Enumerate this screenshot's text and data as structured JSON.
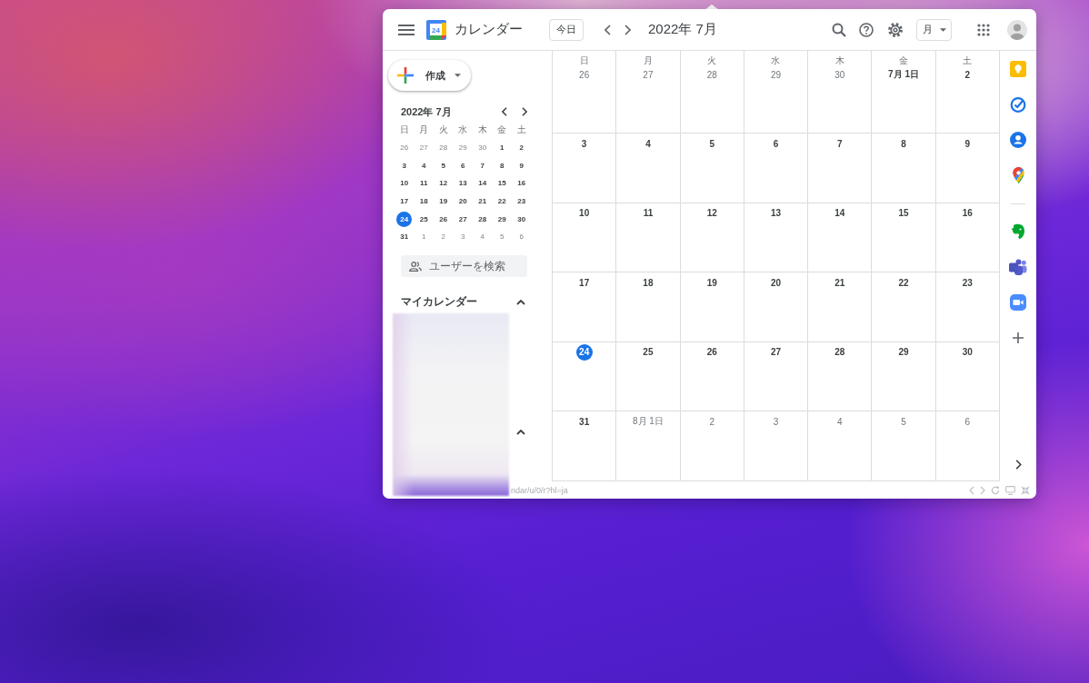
{
  "header": {
    "logo_text": "24",
    "app_name": "カレンダー",
    "today_button": "今日",
    "period": "2022年 7月",
    "view_selector": "月"
  },
  "sidebar": {
    "create_button": "作成",
    "mini_calendar": {
      "title": "2022年 7月",
      "weekdays": [
        "日",
        "月",
        "火",
        "水",
        "木",
        "金",
        "土"
      ],
      "weeks": [
        [
          {
            "label": "26",
            "in_month": false,
            "selected": false
          },
          {
            "label": "27",
            "in_month": false,
            "selected": false
          },
          {
            "label": "28",
            "in_month": false,
            "selected": false
          },
          {
            "label": "29",
            "in_month": false,
            "selected": false
          },
          {
            "label": "30",
            "in_month": false,
            "selected": false
          },
          {
            "label": "1",
            "in_month": true,
            "selected": false
          },
          {
            "label": "2",
            "in_month": true,
            "selected": false
          }
        ],
        [
          {
            "label": "3",
            "in_month": true,
            "selected": false
          },
          {
            "label": "4",
            "in_month": true,
            "selected": false
          },
          {
            "label": "5",
            "in_month": true,
            "selected": false
          },
          {
            "label": "6",
            "in_month": true,
            "selected": false
          },
          {
            "label": "7",
            "in_month": true,
            "selected": false
          },
          {
            "label": "8",
            "in_month": true,
            "selected": false
          },
          {
            "label": "9",
            "in_month": true,
            "selected": false
          }
        ],
        [
          {
            "label": "10",
            "in_month": true,
            "selected": false
          },
          {
            "label": "11",
            "in_month": true,
            "selected": false
          },
          {
            "label": "12",
            "in_month": true,
            "selected": false
          },
          {
            "label": "13",
            "in_month": true,
            "selected": false
          },
          {
            "label": "14",
            "in_month": true,
            "selected": false
          },
          {
            "label": "15",
            "in_month": true,
            "selected": false
          },
          {
            "label": "16",
            "in_month": true,
            "selected": false
          }
        ],
        [
          {
            "label": "17",
            "in_month": true,
            "selected": false
          },
          {
            "label": "18",
            "in_month": true,
            "selected": false
          },
          {
            "label": "19",
            "in_month": true,
            "selected": false
          },
          {
            "label": "20",
            "in_month": true,
            "selected": false
          },
          {
            "label": "21",
            "in_month": true,
            "selected": false
          },
          {
            "label": "22",
            "in_month": true,
            "selected": false
          },
          {
            "label": "23",
            "in_month": true,
            "selected": false
          }
        ],
        [
          {
            "label": "24",
            "in_month": true,
            "selected": true
          },
          {
            "label": "25",
            "in_month": true,
            "selected": false
          },
          {
            "label": "26",
            "in_month": true,
            "selected": false
          },
          {
            "label": "27",
            "in_month": true,
            "selected": false
          },
          {
            "label": "28",
            "in_month": true,
            "selected": false
          },
          {
            "label": "29",
            "in_month": true,
            "selected": false
          },
          {
            "label": "30",
            "in_month": true,
            "selected": false
          }
        ],
        [
          {
            "label": "31",
            "in_month": true,
            "selected": false
          },
          {
            "label": "1",
            "in_month": false,
            "selected": false
          },
          {
            "label": "2",
            "in_month": false,
            "selected": false
          },
          {
            "label": "3",
            "in_month": false,
            "selected": false
          },
          {
            "label": "4",
            "in_month": false,
            "selected": false
          },
          {
            "label": "5",
            "in_month": false,
            "selected": false
          },
          {
            "label": "6",
            "in_month": false,
            "selected": false
          }
        ]
      ]
    },
    "people_search": {
      "placeholder": "ユーザーを検索"
    },
    "calendar_sections": [
      {
        "title": "マイカレンダー",
        "expanded": true
      },
      {
        "expanded": true
      }
    ]
  },
  "calendar": {
    "weekdays": [
      "日",
      "月",
      "火",
      "水",
      "木",
      "金",
      "土"
    ],
    "weeks": [
      [
        {
          "label": "26",
          "in_month": false,
          "today": false
        },
        {
          "label": "27",
          "in_month": false,
          "today": false
        },
        {
          "label": "28",
          "in_month": false,
          "today": false
        },
        {
          "label": "29",
          "in_month": false,
          "today": false
        },
        {
          "label": "30",
          "in_month": false,
          "today": false
        },
        {
          "label": "7月 1日",
          "in_month": true,
          "today": false
        },
        {
          "label": "2",
          "in_month": true,
          "today": false
        }
      ],
      [
        {
          "label": "3",
          "in_month": true,
          "today": false
        },
        {
          "label": "4",
          "in_month": true,
          "today": false
        },
        {
          "label": "5",
          "in_month": true,
          "today": false
        },
        {
          "label": "6",
          "in_month": true,
          "today": false
        },
        {
          "label": "7",
          "in_month": true,
          "today": false
        },
        {
          "label": "8",
          "in_month": true,
          "today": false
        },
        {
          "label": "9",
          "in_month": true,
          "today": false
        }
      ],
      [
        {
          "label": "10",
          "in_month": true,
          "today": false
        },
        {
          "label": "11",
          "in_month": true,
          "today": false
        },
        {
          "label": "12",
          "in_month": true,
          "today": false
        },
        {
          "label": "13",
          "in_month": true,
          "today": false
        },
        {
          "label": "14",
          "in_month": true,
          "today": false
        },
        {
          "label": "15",
          "in_month": true,
          "today": false
        },
        {
          "label": "16",
          "in_month": true,
          "today": false
        }
      ],
      [
        {
          "label": "17",
          "in_month": true,
          "today": false
        },
        {
          "label": "18",
          "in_month": true,
          "today": false
        },
        {
          "label": "19",
          "in_month": true,
          "today": false
        },
        {
          "label": "20",
          "in_month": true,
          "today": false
        },
        {
          "label": "21",
          "in_month": true,
          "today": false
        },
        {
          "label": "22",
          "in_month": true,
          "today": false
        },
        {
          "label": "23",
          "in_month": true,
          "today": false
        }
      ],
      [
        {
          "label": "24",
          "in_month": true,
          "today": true
        },
        {
          "label": "25",
          "in_month": true,
          "today": false
        },
        {
          "label": "26",
          "in_month": true,
          "today": false
        },
        {
          "label": "27",
          "in_month": true,
          "today": false
        },
        {
          "label": "28",
          "in_month": true,
          "today": false
        },
        {
          "label": "29",
          "in_month": true,
          "today": false
        },
        {
          "label": "30",
          "in_month": true,
          "today": false
        }
      ],
      [
        {
          "label": "31",
          "in_month": true,
          "today": false
        },
        {
          "label": "8月 1日",
          "in_month": false,
          "today": false
        },
        {
          "label": "2",
          "in_month": false,
          "today": false
        },
        {
          "label": "3",
          "in_month": false,
          "today": false
        },
        {
          "label": "4",
          "in_month": false,
          "today": false
        },
        {
          "label": "5",
          "in_month": false,
          "today": false
        },
        {
          "label": "6",
          "in_month": false,
          "today": false
        }
      ]
    ]
  },
  "status_bar": {
    "url": "ndar/u/0/r?hl=ja"
  }
}
